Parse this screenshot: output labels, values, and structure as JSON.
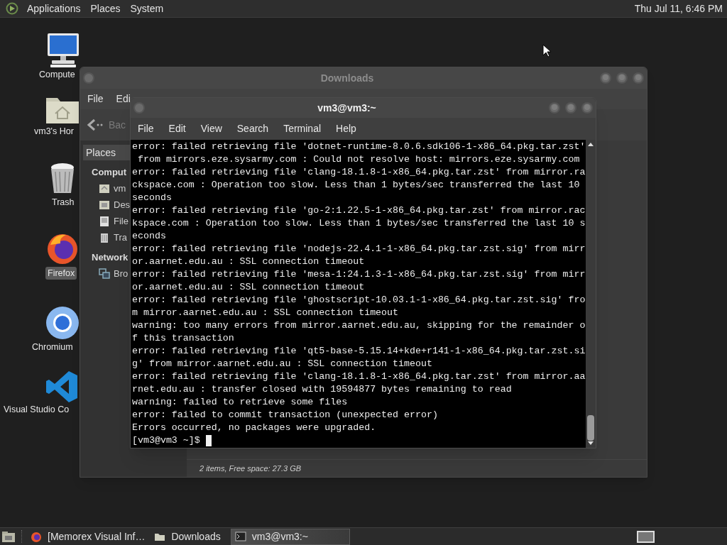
{
  "top_panel": {
    "menus": [
      "Applications",
      "Places",
      "System"
    ],
    "clock": "Thu Jul 11, 6:46 PM"
  },
  "desktop_icons": [
    {
      "label": "Compute",
      "kind": "computer",
      "selected": false
    },
    {
      "label": "vm3's Hor",
      "kind": "home",
      "selected": false
    },
    {
      "label": "Trash",
      "kind": "trash",
      "selected": false
    },
    {
      "label": "Firefox",
      "kind": "firefox",
      "selected": true
    },
    {
      "label": "Chromium",
      "kind": "chromium",
      "selected": false
    },
    {
      "label": "Visual Studio Co",
      "kind": "vscode",
      "selected": false
    }
  ],
  "file_manager": {
    "title": "Downloads",
    "menus": [
      "File",
      "Edi"
    ],
    "back_label": "Bac",
    "sidebar_header": "Places",
    "sidebar": [
      {
        "label": "Comput",
        "kind": "heading"
      },
      {
        "label": "vm",
        "kind": "home"
      },
      {
        "label": "Des",
        "kind": "desktop"
      },
      {
        "label": "File",
        "kind": "drive"
      },
      {
        "label": "Tra",
        "kind": "trash"
      },
      {
        "label": "Network",
        "kind": "heading"
      },
      {
        "label": "Bro",
        "kind": "network"
      }
    ],
    "status": "2 items, Free space: 27.3 GB"
  },
  "terminal": {
    "title": "vm3@vm3:~",
    "menus": [
      "File",
      "Edit",
      "View",
      "Search",
      "Terminal",
      "Help"
    ],
    "lines": [
      "error: failed retrieving file 'dotnet-runtime-8.0.6.sdk106-1-x86_64.pkg.tar.zst'",
      " from mirrors.eze.sysarmy.com : Could not resolve host: mirrors.eze.sysarmy.com",
      "error: failed retrieving file 'clang-18.1.8-1-x86_64.pkg.tar.zst' from mirror.ra",
      "ckspace.com : Operation too slow. Less than 1 bytes/sec transferred the last 10",
      "seconds",
      "error: failed retrieving file 'go-2:1.22.5-1-x86_64.pkg.tar.zst' from mirror.rac",
      "kspace.com : Operation too slow. Less than 1 bytes/sec transferred the last 10 s",
      "econds",
      "error: failed retrieving file 'nodejs-22.4.1-1-x86_64.pkg.tar.zst.sig' from mirr",
      "or.aarnet.edu.au : SSL connection timeout",
      "error: failed retrieving file 'mesa-1:24.1.3-1-x86_64.pkg.tar.zst.sig' from mirr",
      "or.aarnet.edu.au : SSL connection timeout",
      "error: failed retrieving file 'ghostscript-10.03.1-1-x86_64.pkg.tar.zst.sig' fro",
      "m mirror.aarnet.edu.au : SSL connection timeout",
      "warning: too many errors from mirror.aarnet.edu.au, skipping for the remainder o",
      "f this transaction",
      "error: failed retrieving file 'qt5-base-5.15.14+kde+r141-1-x86_64.pkg.tar.zst.si",
      "g' from mirror.aarnet.edu.au : SSL connection timeout",
      "error: failed retrieving file 'clang-18.1.8-1-x86_64.pkg.tar.zst' from mirror.aa",
      "rnet.edu.au : transfer closed with 19594877 bytes remaining to read",
      "warning: failed to retrieve some files",
      "error: failed to commit transaction (unexpected error)",
      "Errors occurred, no packages were upgraded."
    ],
    "prompt": "[vm3@vm3 ~]$"
  },
  "taskbar": {
    "items": [
      {
        "label": "[Memorex Visual Inf…",
        "kind": "firefox",
        "selected": false
      },
      {
        "label": "Downloads",
        "kind": "folder",
        "selected": false
      },
      {
        "label": "vm3@vm3:~",
        "kind": "terminal",
        "selected": true
      }
    ]
  }
}
